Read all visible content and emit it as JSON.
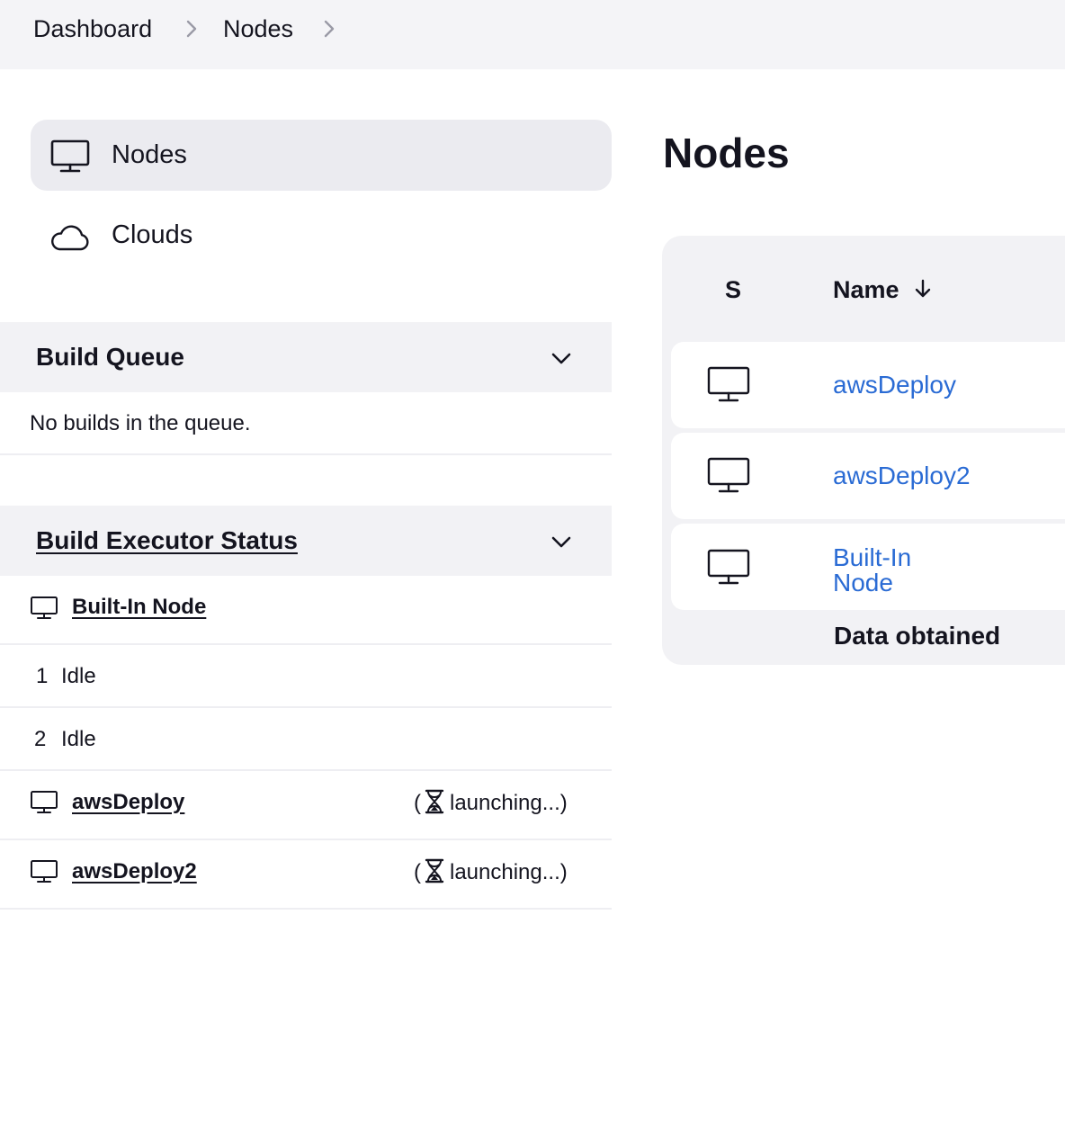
{
  "breadcrumb": {
    "items": [
      "Dashboard",
      "Nodes"
    ]
  },
  "sidebar": {
    "items": [
      {
        "label": "Nodes",
        "icon": "monitor-icon",
        "active": true
      },
      {
        "label": "Clouds",
        "icon": "cloud-icon",
        "active": false
      }
    ]
  },
  "build_queue": {
    "title": "Build Queue",
    "empty_text": "No builds in the queue."
  },
  "executor_status": {
    "title": "Build Executor Status",
    "nodes": [
      {
        "name": "Built-In Node",
        "executors": [
          {
            "number": "1",
            "status": "Idle"
          },
          {
            "number": "2",
            "status": "Idle"
          }
        ]
      },
      {
        "name": "awsDeploy",
        "status_text": "launching...)",
        "status_prefix": "("
      },
      {
        "name": "awsDeploy2",
        "status_text": "launching...)",
        "status_prefix": "("
      }
    ]
  },
  "main": {
    "title": "Nodes",
    "table": {
      "headers": {
        "status": "S",
        "name": "Name"
      },
      "rows": [
        {
          "name": "awsDeploy"
        },
        {
          "name": "awsDeploy2"
        },
        {
          "name": "Built-In Node"
        }
      ],
      "footer": "Data obtained"
    }
  },
  "colors": {
    "link": "#2a6bd4",
    "header_bg": "#f4f4f7",
    "panel_bg": "#f2f2f5",
    "active_bg": "#ebebf0"
  }
}
